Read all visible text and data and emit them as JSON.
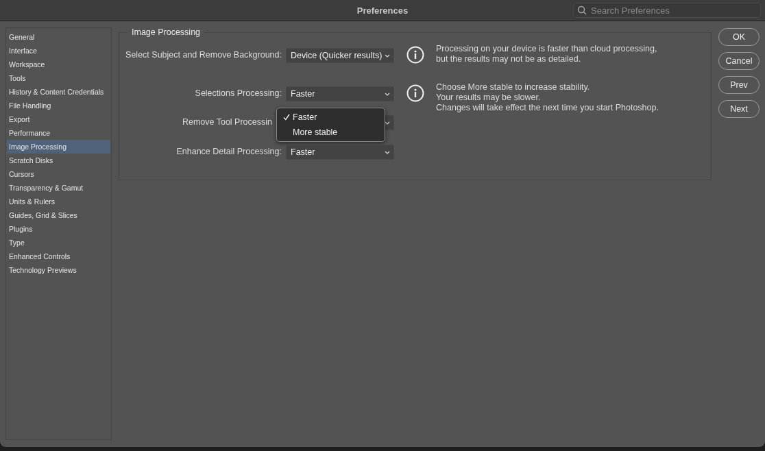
{
  "window": {
    "title": "Preferences"
  },
  "search": {
    "placeholder": "Search Preferences"
  },
  "sidebar": {
    "items": [
      {
        "label": "General",
        "selected": false
      },
      {
        "label": "Interface",
        "selected": false
      },
      {
        "label": "Workspace",
        "selected": false
      },
      {
        "label": "Tools",
        "selected": false
      },
      {
        "label": "History & Content Credentials",
        "selected": false
      },
      {
        "label": "File Handling",
        "selected": false
      },
      {
        "label": "Export",
        "selected": false
      },
      {
        "label": "Performance",
        "selected": false
      },
      {
        "label": "Image Processing",
        "selected": true
      },
      {
        "label": "Scratch Disks",
        "selected": false
      },
      {
        "label": "Cursors",
        "selected": false
      },
      {
        "label": "Transparency & Gamut",
        "selected": false
      },
      {
        "label": "Units & Rulers",
        "selected": false
      },
      {
        "label": "Guides, Grid & Slices",
        "selected": false
      },
      {
        "label": "Plugins",
        "selected": false
      },
      {
        "label": "Type",
        "selected": false
      },
      {
        "label": "Enhanced Controls",
        "selected": false
      },
      {
        "label": "Technology Previews",
        "selected": false
      }
    ]
  },
  "group": {
    "title": "Image Processing",
    "rows": [
      {
        "label": "Select Subject and Remove Background:",
        "value": "Device (Quicker results)",
        "info": [
          "Processing on your device is faster than cloud processing,",
          "but the results may not be as detailed."
        ]
      },
      {
        "label": "Selections Processing:",
        "value": "Faster",
        "info": [
          "Choose More stable to increase stability.",
          "Your results may be slower.",
          "Changes will take effect the next time you start Photoshop."
        ]
      },
      {
        "label": "Remove Tool Processin",
        "open": true,
        "options": [
          {
            "label": "Faster",
            "selected": true
          },
          {
            "label": "More stable",
            "selected": false
          }
        ]
      },
      {
        "label": "Enhance Detail Processing:",
        "value": "Faster"
      }
    ]
  },
  "buttons": [
    "OK",
    "Cancel",
    "Prev",
    "Next"
  ]
}
